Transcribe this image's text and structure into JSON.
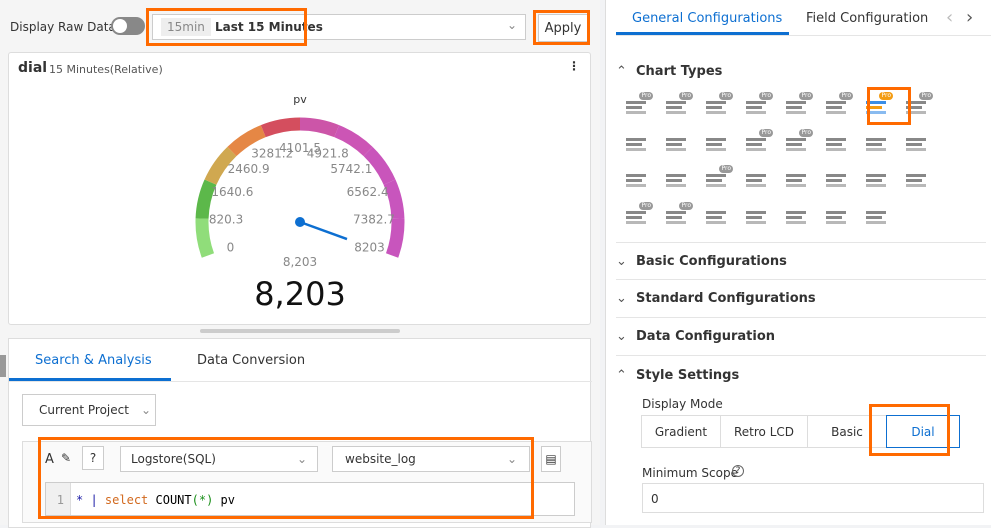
{
  "toolbar": {
    "raw_label": "Display Raw Data",
    "raw_on": false,
    "time_tag": "15min",
    "time_label": "Last 15 Minutes",
    "apply": "Apply"
  },
  "chart_card": {
    "title": "dial",
    "subtitle": "15 Minutes(Relative)",
    "more_icon": "more-vertical-icon"
  },
  "gauge": {
    "series_name": "pv",
    "min": 0,
    "max": 8203,
    "value": 8203,
    "value_small": "8,203",
    "value_big": "8,203",
    "ticks": [
      "0",
      "820.3",
      "1640.6",
      "2460.9",
      "3281.2",
      "4101.5",
      "4921.8",
      "5742.1",
      "6562.4",
      "7382.7",
      "8203"
    ],
    "colors": [
      "#90dd7a",
      "#5cb84a",
      "#d0a850",
      "#e58745",
      "#d44e5e",
      "#cc55a8",
      "#cc55b5",
      "#c955bb",
      "#c855bd",
      "#c855bd"
    ],
    "needle_color": "#0d6fd1"
  },
  "query": {
    "tabs": [
      "Search & Analysis",
      "Data Conversion"
    ],
    "project": "Current Project",
    "store_type": "Logstore(SQL)",
    "logstore": "website_log",
    "line_no": "1",
    "code": [
      {
        "t": "*",
        "c": "#1a1aa6"
      },
      {
        "t": " | ",
        "c": "#1a1aa6"
      },
      {
        "t": "select",
        "c": "#d2691e"
      },
      {
        "t": " COUNT",
        "c": "#000"
      },
      {
        "t": "(*)",
        "c": "#1a8f1a"
      },
      {
        "t": " pv",
        "c": "#000"
      }
    ]
  },
  "right": {
    "tabs": [
      "General Configurations",
      "Field Configuration"
    ],
    "chart_types_label": "Chart Types",
    "icons": [
      "table-pro",
      "line-pro",
      "bar-pro",
      "area-pro",
      "single-value-pro",
      "flow-pro",
      "dial-pro",
      "pie-pro",
      "histogram",
      "radar",
      "cross-table",
      "scatter-pro",
      "bubble-pro",
      "funnel-table",
      "china-map",
      "world-map",
      "image",
      "markdown",
      "list-pro",
      "candlestick",
      "timeline",
      "word-cloud",
      "topology",
      "column",
      "map-pro",
      "amap-pro",
      "location",
      "treemap",
      "bar-line",
      "funnel",
      "property-table"
    ],
    "sections": [
      "Basic Configurations",
      "Standard Configurations",
      "Data Configuration",
      "Style Settings"
    ],
    "display_mode_label": "Display Mode",
    "modes": [
      "Gradient",
      "Retro LCD",
      "Basic",
      "Dial"
    ],
    "active_mode": "Dial",
    "min_scope_label": "Minimum Scope",
    "min_scope_value": "0"
  }
}
